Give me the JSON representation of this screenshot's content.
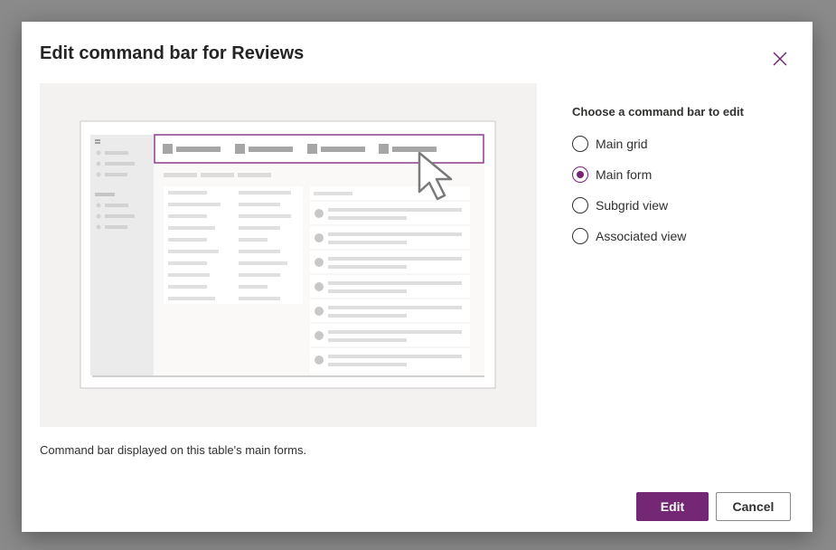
{
  "dialog": {
    "title": "Edit command bar for Reviews",
    "close_icon": "close-icon",
    "description": "Command bar displayed on this table's main forms.",
    "choose_label": "Choose a command bar to edit",
    "options": [
      {
        "label": "Main grid",
        "selected": false
      },
      {
        "label": "Main form",
        "selected": true
      },
      {
        "label": "Subgrid view",
        "selected": false
      },
      {
        "label": "Associated view",
        "selected": false
      }
    ],
    "buttons": {
      "edit": "Edit",
      "cancel": "Cancel"
    }
  },
  "colors": {
    "accent": "#742774",
    "overlay": "#8a8a8a",
    "preview_bg": "#f3f2f1"
  },
  "preview": {
    "illustration": "command-bar-illustration",
    "pointer_icon": "cursor-arrow-icon"
  }
}
